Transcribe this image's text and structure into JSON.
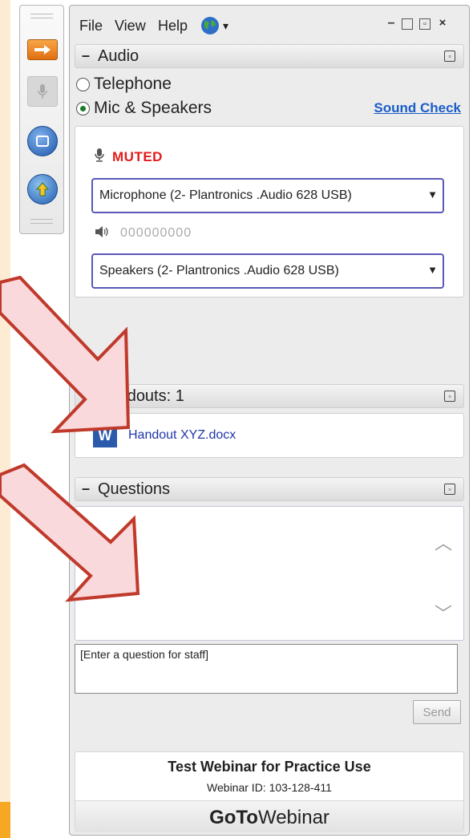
{
  "menubar": {
    "file": "File",
    "view": "View",
    "help": "Help",
    "globe_dropdown": "▾"
  },
  "audio": {
    "title": "Audio",
    "telephone": "Telephone",
    "mic_speakers": "Mic & Speakers",
    "selected": "Mic & Speakers",
    "sound_check": "Sound Check",
    "muted": "MUTED",
    "microphone_select": "Microphone (2- Plantronics .Audio 628 USB)",
    "speakers_select": "Speakers (2- Plantronics .Audio 628 USB)",
    "speaker_level": "000000000"
  },
  "handouts": {
    "title": "Handouts: 1",
    "items": [
      {
        "icon": "W",
        "name": "Handout XYZ.docx"
      }
    ]
  },
  "questions": {
    "title": "Questions",
    "input_placeholder": "[Enter a question for staff]",
    "send_label": "Send"
  },
  "footer": {
    "webinar_title": "Test Webinar for Practice Use",
    "webinar_id": "Webinar ID: 103-128-411",
    "brand_bold": "GoTo",
    "brand_regular": "Webinar"
  },
  "colors": {
    "muted_red": "#e21b1b",
    "link_blue": "#1a5dc8",
    "annotation_arrow_fill": "#f9d9dc",
    "annotation_arrow_stroke": "#c0392b",
    "accent_orange": "#f7a823"
  }
}
